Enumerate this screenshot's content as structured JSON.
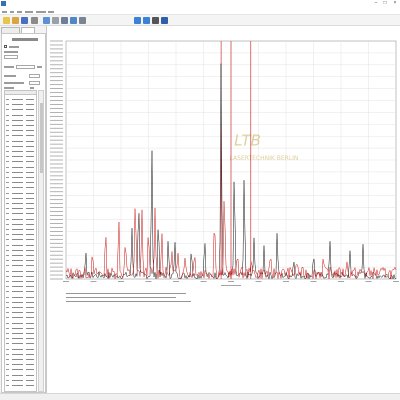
{
  "window": {
    "title": ""
  },
  "menu": {
    "items": [
      {
        "name": "menu-item-1",
        "label": ""
      },
      {
        "name": "menu-item-2",
        "label": ""
      },
      {
        "name": "menu-item-3",
        "label": ""
      },
      {
        "name": "menu-item-4",
        "label": ""
      },
      {
        "name": "menu-item-5",
        "label": ""
      },
      {
        "name": "menu-item-6",
        "label": ""
      }
    ]
  },
  "toolbar": {
    "buttons": [
      {
        "name": "toolbar-button-1",
        "icon": "new-icon",
        "color": "#e8c44a"
      },
      {
        "name": "toolbar-button-2",
        "icon": "open-icon",
        "color": "#d9a441"
      },
      {
        "name": "toolbar-button-3",
        "icon": "save-icon",
        "color": "#4a6fc1"
      },
      {
        "name": "toolbar-button-4",
        "icon": "grid-icon",
        "color": "#8a8a8a"
      },
      {
        "name": "toolbar-button-5",
        "icon": "spectrum-view-icon",
        "color": "#5b8fd6"
      },
      {
        "name": "toolbar-button-6",
        "icon": "zoom-icon",
        "color": "#9aa0a8"
      },
      {
        "name": "toolbar-button-7",
        "icon": "chart-icon",
        "color": "#6f7f98"
      },
      {
        "name": "toolbar-button-8",
        "icon": "peak-icon",
        "color": "#4f86c6"
      },
      {
        "name": "toolbar-button-9",
        "icon": "table-icon",
        "color": "#7a8594"
      },
      {
        "name": "toolbar-button-10",
        "icon": "arrow-left-icon",
        "color": "#3b82d6"
      },
      {
        "name": "toolbar-button-11",
        "icon": "arrow-right-icon",
        "color": "#3b82d6"
      },
      {
        "name": "toolbar-button-12",
        "icon": "refresh-icon",
        "color": "#555555"
      },
      {
        "name": "toolbar-button-13",
        "icon": "info-icon",
        "color": "#2f5fa8"
      }
    ]
  },
  "panel": {
    "tabs": [
      {
        "label": "",
        "active": false
      },
      {
        "label": "",
        "active": true
      }
    ],
    "heading": ""
  },
  "chart": {
    "title": "",
    "watermark": "LTB LASERTECHNIK BERLIN",
    "colors": {
      "black_trace": "#111111",
      "red_trace": "#cc1111",
      "markers": "#cc1111",
      "grid": "#dcdcdc",
      "watermark": "#d9c98e"
    }
  },
  "chart_data": {
    "type": "line",
    "title": "",
    "xlabel": "",
    "ylabel": "",
    "xlim": [
      0,
      1
    ],
    "ylim": [
      0,
      1
    ],
    "grid": true,
    "series": [
      {
        "name": "",
        "color": "#111111",
        "peaks": [
          [
            0.06,
            0.11
          ],
          [
            0.2,
            0.2
          ],
          [
            0.22,
            0.32
          ],
          [
            0.26,
            0.55
          ],
          [
            0.28,
            0.24
          ],
          [
            0.31,
            0.15
          ],
          [
            0.33,
            0.13
          ],
          [
            0.38,
            0.12
          ],
          [
            0.42,
            0.16
          ],
          [
            0.47,
            0.9
          ],
          [
            0.51,
            0.45
          ],
          [
            0.54,
            0.42
          ],
          [
            0.57,
            0.16
          ],
          [
            0.6,
            0.12
          ],
          [
            0.64,
            0.18
          ],
          [
            0.69,
            0.07
          ],
          [
            0.75,
            0.09
          ],
          [
            0.8,
            0.15
          ],
          [
            0.86,
            0.1
          ],
          [
            0.9,
            0.12
          ]
        ]
      },
      {
        "name": "",
        "color": "#cc1111",
        "peaks": [
          [
            0.08,
            0.06
          ],
          [
            0.12,
            0.16
          ],
          [
            0.16,
            0.22
          ],
          [
            0.18,
            0.14
          ],
          [
            0.21,
            0.31
          ],
          [
            0.23,
            0.27
          ],
          [
            0.25,
            0.2
          ],
          [
            0.27,
            0.27
          ],
          [
            0.29,
            0.18
          ],
          [
            0.32,
            0.1
          ],
          [
            0.34,
            0.08
          ],
          [
            0.36,
            0.09
          ],
          [
            0.39,
            0.1
          ],
          [
            0.45,
            0.24
          ],
          [
            0.48,
            0.36
          ],
          [
            0.52,
            0.09
          ],
          [
            0.56,
            0.07
          ],
          [
            0.62,
            0.05
          ],
          [
            0.7,
            0.05
          ],
          [
            0.78,
            0.06
          ],
          [
            0.85,
            0.05
          ]
        ]
      }
    ],
    "markers": [
      0.47,
      0.5,
      0.56
    ]
  },
  "status": {
    "text": ""
  }
}
